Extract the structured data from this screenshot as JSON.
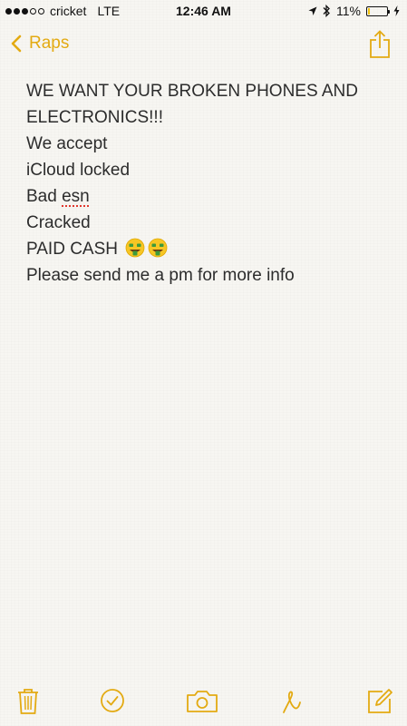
{
  "status_bar": {
    "carrier": "cricket",
    "network": "LTE",
    "time": "12:46 AM",
    "battery_percent": "11%",
    "battery_level": 0.11,
    "signal_bars_filled": 3,
    "signal_bars_total": 5
  },
  "nav": {
    "back_label": "Raps",
    "accent_color": "#e3aa12"
  },
  "note": {
    "line1": "WE WANT YOUR BROKEN PHONES AND",
    "line2": "ELECTRONICS!!!",
    "line3": "We accept",
    "line4": "iCloud locked",
    "line5_prefix": "Bad ",
    "line5_misspelled": "esn",
    "line6": "Cracked",
    "line7": "PAID CASH",
    "line7_emoji": "money-mouth-face-icon",
    "line8": "Please send me a pm for more info"
  },
  "toolbar": {
    "icons": [
      "trash-icon",
      "checklist-icon",
      "camera-icon",
      "sketch-icon",
      "compose-icon"
    ]
  }
}
